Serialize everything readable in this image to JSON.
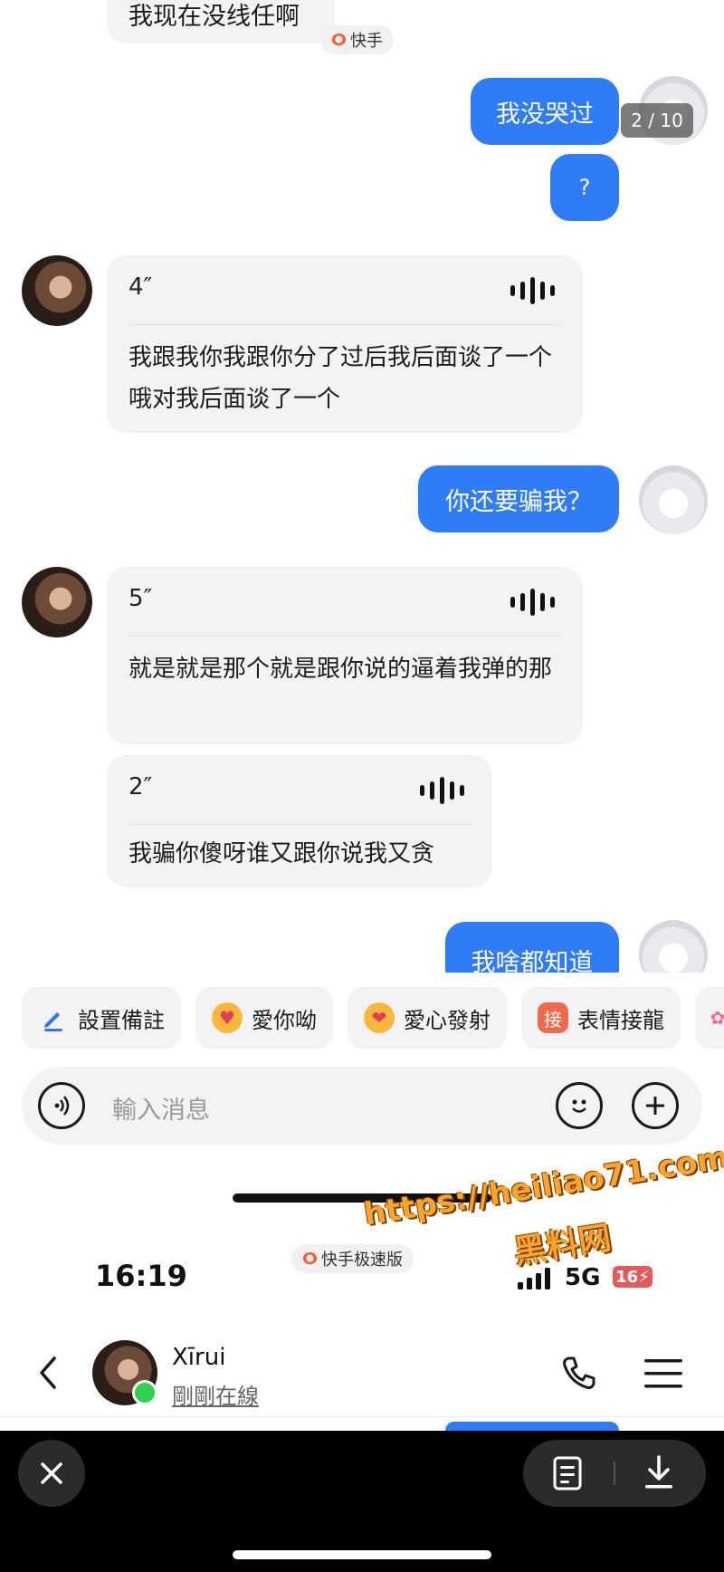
{
  "messages": {
    "top_incoming_text": "我现在没线任啊",
    "out1_text": "我没哭过",
    "image_counter": "2 / 10",
    "out2_text": "?",
    "voice1": {
      "duration": "4″",
      "transcript": "我跟我你我跟你分了过后我后面谈了一个哦对我后面谈了一个"
    },
    "out3_text": "你还要骗我？",
    "voice2": {
      "duration": "5″",
      "transcript": "就是就是那个就是跟你说的逼着我弹的那"
    },
    "voice3": {
      "duration": "2″",
      "transcript": "我骗你傻呀谁又跟你说我又贪"
    },
    "out4_text": "我啥都知道"
  },
  "app_badge_top": "快手",
  "quick_actions": [
    {
      "label": "設置備註",
      "icon": "pencil-icon",
      "color": "#3b74f0"
    },
    {
      "label": "愛你呦",
      "icon": "heart-eyes-emoji-icon",
      "color": "#f5a623"
    },
    {
      "label": "愛心發射",
      "icon": "hearts-emoji-icon",
      "color": "#f5a623"
    },
    {
      "label": "表情接龍",
      "icon": "jie-badge-icon",
      "glyph": "接",
      "color": "#ef6a4c"
    }
  ],
  "input": {
    "placeholder": "輸入消息"
  },
  "status_bar": {
    "time": "16:19",
    "network": "5G",
    "battery": "16⚡",
    "app_badge": "快手极速版"
  },
  "watermark": {
    "line1": "https://heiliao71.com",
    "line2": "黑料网"
  },
  "header": {
    "name": "Xīrui",
    "status": "剛剛在線"
  },
  "colors": {
    "accent": "#2f7cf6",
    "bubble_in": "#f3f3f5",
    "watermark": "#ffa42b"
  }
}
